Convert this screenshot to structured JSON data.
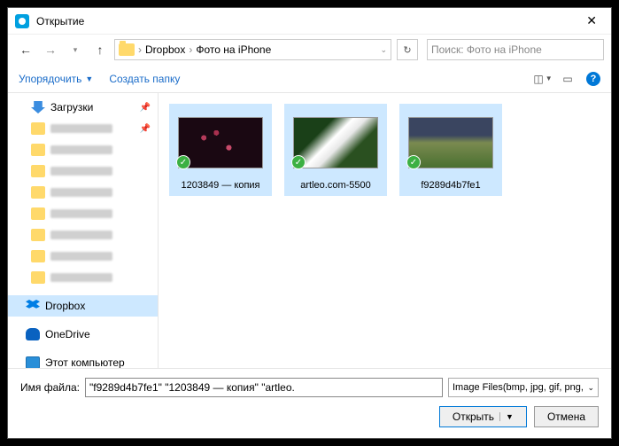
{
  "window": {
    "title": "Открытие"
  },
  "nav": {
    "path": [
      "Dropbox",
      "Фото на iPhone"
    ],
    "search_placeholder": "Поиск: Фото на iPhone"
  },
  "toolbar": {
    "organize": "Упорядочить",
    "new_folder": "Создать папку"
  },
  "sidebar": {
    "downloads": "Загрузки",
    "dropbox": "Dropbox",
    "onedrive": "OneDrive",
    "this_pc": "Этот компьютер"
  },
  "files": [
    {
      "name": "1203849 — копия"
    },
    {
      "name": "artleo.com-5500"
    },
    {
      "name": "f9289d4b7fe1"
    }
  ],
  "footer": {
    "filename_label": "Имя файла:",
    "filename_value": "\"f9289d4b7fe1\" \"1203849 — копия\" \"artleo.",
    "filter": "Image Files(bmp, jpg, gif, png,",
    "open": "Открыть",
    "cancel": "Отмена"
  }
}
